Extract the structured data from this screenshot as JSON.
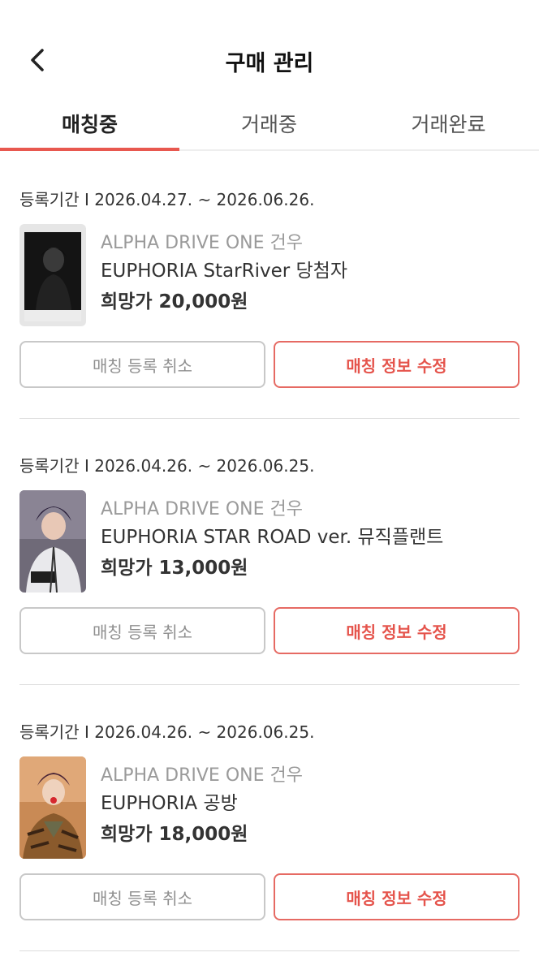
{
  "header": {
    "title": "구매 관리",
    "back_icon": "chevron-left-icon"
  },
  "tabs": [
    {
      "label": "매칭중",
      "active": true
    },
    {
      "label": "거래중",
      "active": false
    },
    {
      "label": "거래완료",
      "active": false
    }
  ],
  "colors": {
    "accent": "#e8584f",
    "muted_text": "#9a9a9a",
    "border": "#c8c8c8"
  },
  "items": [
    {
      "period": "등록기간 I 2026.04.27. ~ 2026.06.26.",
      "group": "ALPHA DRIVE ONE",
      "member": "건우",
      "name": "EUPHORIA StarRiver 당첨자",
      "price": "희망가 20,000원",
      "cancel_label": "매칭 등록 취소",
      "edit_label": "매칭 정보 수정"
    },
    {
      "period": "등록기간 I 2026.04.26. ~ 2026.06.25.",
      "group": "ALPHA DRIVE ONE",
      "member": "건우",
      "name": "EUPHORIA STAR ROAD ver. 뮤직플랜트",
      "price": "희망가 13,000원",
      "cancel_label": "매칭 등록 취소",
      "edit_label": "매칭 정보 수정"
    },
    {
      "period": "등록기간 I 2026.04.26. ~ 2026.06.25.",
      "group": "ALPHA DRIVE ONE",
      "member": "건우",
      "name": "EUPHORIA 공방",
      "price": "희망가 18,000원",
      "cancel_label": "매칭 등록 취소",
      "edit_label": "매칭 정보 수정"
    }
  ]
}
